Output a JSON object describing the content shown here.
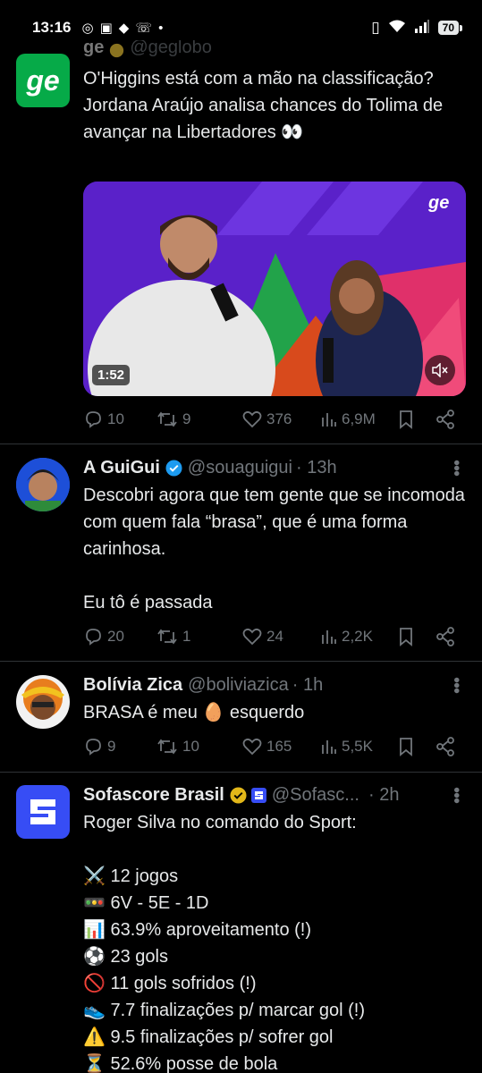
{
  "status_bar": {
    "time": "13:16",
    "notification_icons": [
      "whatsapp-icon",
      "instagram-icon",
      "chat-icon",
      "missed-call-icon",
      "dot-icon"
    ],
    "battery": "70"
  },
  "tweets": [
    {
      "name": "ge",
      "handle": "@geglobo",
      "text": "O'Higgins está com a mão na classificação? Jordana Araújo analisa chances do Tolima de avançar na Libertadores 👀",
      "media": {
        "duration": "1:52",
        "logo_text": "ge"
      },
      "replies": "10",
      "reposts": "9",
      "likes": "376",
      "views": "6,9M"
    },
    {
      "name": "A GuiGui",
      "handle": "@souaguigui",
      "time": "· 13h",
      "text": "Descobri agora que tem gente que se incomoda com quem fala “brasa”, que é uma forma carinhosa.\n\nEu tô é passada",
      "replies": "20",
      "reposts": "1",
      "likes": "24",
      "views": "2,2K"
    },
    {
      "name": "Bolívia Zica",
      "handle": "@boliviazica",
      "time": "· 1h",
      "text": "BRASA é meu 🥚 esquerdo",
      "replies": "9",
      "reposts": "10",
      "likes": "165",
      "views": "5,5K"
    },
    {
      "name": "Sofascore Brasil",
      "handle": "@Sofasc...",
      "time": "· 2h",
      "text": "Roger Silva no comando do Sport:\n\n⚔️ 12 jogos\n🚥 6V - 5E - 1D\n📊 63.9% aproveitamento (!)\n⚽ 23 gols\n🚫 11 gols sofridos (!)\n👟 7.7 finalizações p/ marcar gol (!)\n⚠️ 9.5 finalizações p/ sofrer gol\n⏳ 52.6% posse de bola"
    }
  ],
  "colors": {
    "background": "#000000",
    "text": "#e7e9ea",
    "muted": "#71767b",
    "verified_blue": "#1d9bf0",
    "verified_gold": "#e2b719",
    "ge_green": "#06aa48",
    "sofascore_blue": "#374df5"
  }
}
